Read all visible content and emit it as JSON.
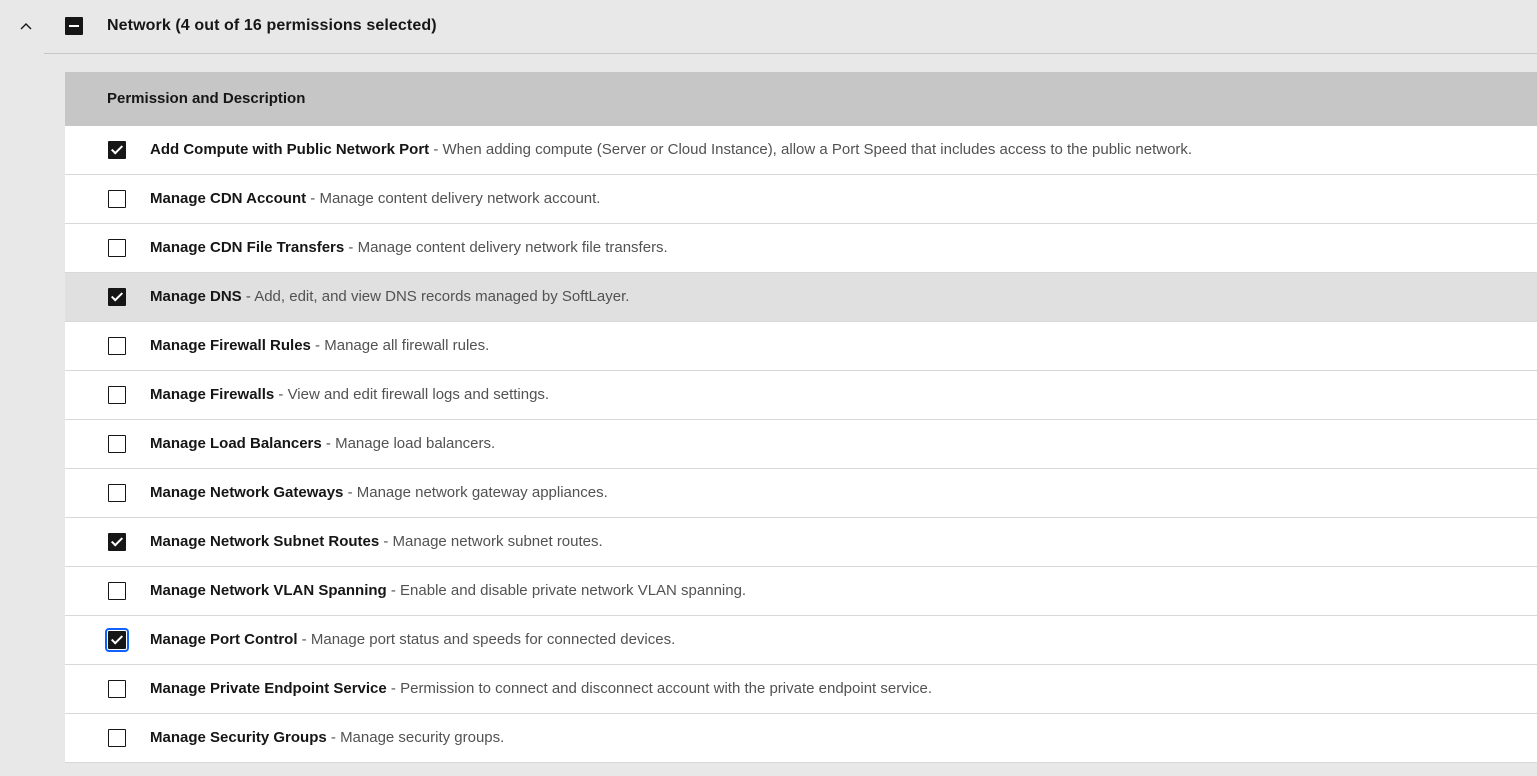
{
  "group": {
    "title": "Network (4 out of 16 permissions selected)",
    "expanded": true,
    "checkbox_state": "indeterminate"
  },
  "table": {
    "header": "Permission and Description",
    "separator": " - ",
    "rows": [
      {
        "name": "Add Compute with Public Network Port",
        "description": "When adding compute (Server or Cloud Instance), allow a Port Speed that includes access to the public network.",
        "checked": true
      },
      {
        "name": "Manage CDN Account",
        "description": "Manage content delivery network account.",
        "checked": false
      },
      {
        "name": "Manage CDN File Transfers",
        "description": "Manage content delivery network file transfers.",
        "checked": false
      },
      {
        "name": "Manage DNS",
        "description": "Add, edit, and view DNS records managed by SoftLayer.",
        "checked": true,
        "hovered": true
      },
      {
        "name": "Manage Firewall Rules",
        "description": "Manage all firewall rules.",
        "checked": false
      },
      {
        "name": "Manage Firewalls",
        "description": "View and edit firewall logs and settings.",
        "checked": false
      },
      {
        "name": "Manage Load Balancers",
        "description": "Manage load balancers.",
        "checked": false
      },
      {
        "name": "Manage Network Gateways",
        "description": "Manage network gateway appliances.",
        "checked": false
      },
      {
        "name": "Manage Network Subnet Routes",
        "description": "Manage network subnet routes.",
        "checked": true
      },
      {
        "name": "Manage Network VLAN Spanning",
        "description": "Enable and disable private network VLAN spanning.",
        "checked": false
      },
      {
        "name": "Manage Port Control",
        "description": "Manage port status and speeds for connected devices.",
        "checked": true,
        "focused": true
      },
      {
        "name": "Manage Private Endpoint Service",
        "description": "Permission to connect and disconnect account with the private endpoint service.",
        "checked": false
      },
      {
        "name": "Manage Security Groups",
        "description": "Manage security groups.",
        "checked": false
      }
    ]
  },
  "icons": {
    "expand": "chevron-up-icon",
    "group_checkbox": "indeterminate-checkbox-icon"
  },
  "colors": {
    "page_bg": "#e8e8e8",
    "header_bg": "#c6c6c6",
    "row_bg": "#ffffff",
    "row_hover_bg": "#e0e0e0",
    "checkbox": "#161616",
    "focus": "#0f62fe",
    "description_text": "#525252"
  }
}
